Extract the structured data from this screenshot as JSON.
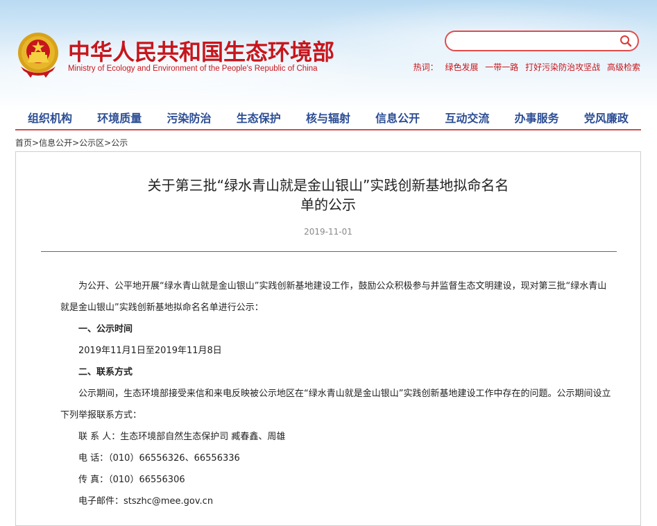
{
  "site": {
    "title": "中华人民共和国生态环境部",
    "subtitle": "Ministry of Ecology and Environment of the People's Republic of China"
  },
  "search": {
    "placeholder": "",
    "value": ""
  },
  "hot": {
    "label": "热词：",
    "links": [
      "绿色发展",
      "一带一路",
      "打好污染防治攻坚战"
    ],
    "advanced": "高级检索"
  },
  "nav": [
    "组织机构",
    "环境质量",
    "污染防治",
    "生态保护",
    "核与辐射",
    "信息公开",
    "互动交流",
    "办事服务",
    "党风廉政"
  ],
  "breadcrumb": [
    "首页",
    "信息公开",
    "公示区",
    "公示"
  ],
  "breadcrumb_sep": ">",
  "article": {
    "title_line1": "关于第三批“绿水青山就是金山银山”实践创新基地拟命名名",
    "title_line2": "单的公示",
    "date": "2019-11-01",
    "p1": "为公开、公平地开展“绿水青山就是金山银山”实践创新基地建设工作，鼓励公众积极参与并监督生态文明建设，现对第三批“绿水青山就是金山银山”实践创新基地拟命名名单进行公示：",
    "h1": "一、公示时间",
    "p2": "2019年11月1日至2019年11月8日",
    "h2": "二、联系方式",
    "p3": "公示期间，生态环境部接受来信和来电反映被公示地区在“绿水青山就是金山银山”实践创新基地建设工作中存在的问题。公示期间设立下列举报联系方式：",
    "contact": "联 系 人：生态环境部自然生态保护司 臧春鑫、周雄",
    "phone": "电    话：（010）66556326、66556336",
    "fax": "传    真：（010）66556306",
    "email": "电子邮件：stszhc@mee.gov.cn"
  },
  "colors": {
    "brand_red": "#c7161c",
    "nav_blue": "#2b4d94",
    "rule_blue": "#3b6fb7"
  }
}
